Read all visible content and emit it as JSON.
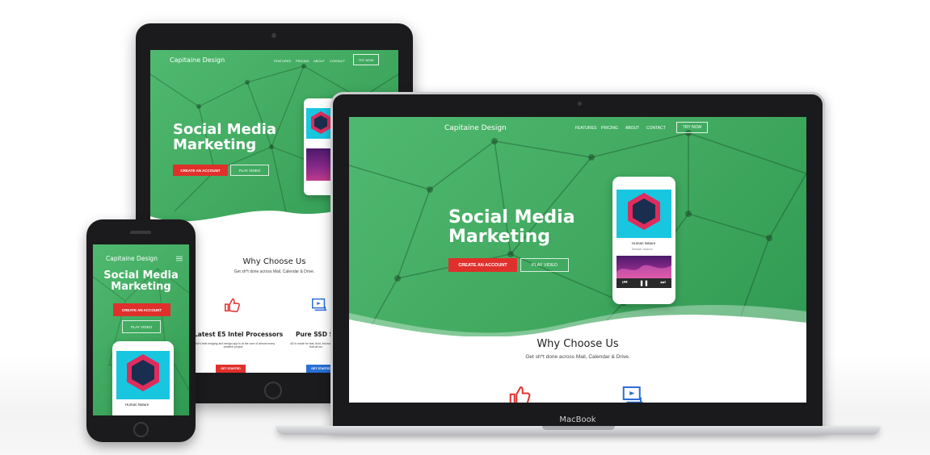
{
  "site": {
    "brand": "Capitaine Design",
    "nav": [
      "FEATURES",
      "PRICING",
      "ABOUT",
      "CONTACT"
    ],
    "try_label": "TRY NOW",
    "hero_title_line1": "Social Media",
    "hero_title_line2": "Marketing",
    "create_account_label": "CREATE AN ACCOUNT",
    "play_video_label": "PLAY VIDEO",
    "why_title": "Why Choose Us",
    "why_sub": "Get sh*t done across Mail, Calendar & Drive.",
    "feature1_title": "Latest E5 Intel Processors",
    "feature1_text": "world's best imaging and design app is at the core of almost every creative project.",
    "feature2_title": "Pure SSD Sto",
    "feature2_text": "4D is made for fast, fluid, innovative tools that all mo",
    "get_started_label": "GET STARTED"
  },
  "player": {
    "track": "Human Nature",
    "artist": "Michael Jackson",
    "time_start": "0:45",
    "time_end": "3:46"
  },
  "devices": {
    "laptop_label": "MacBook"
  },
  "colors": {
    "green": "#4caf6a",
    "red": "#e0302c",
    "blue": "#2a6fd6"
  }
}
